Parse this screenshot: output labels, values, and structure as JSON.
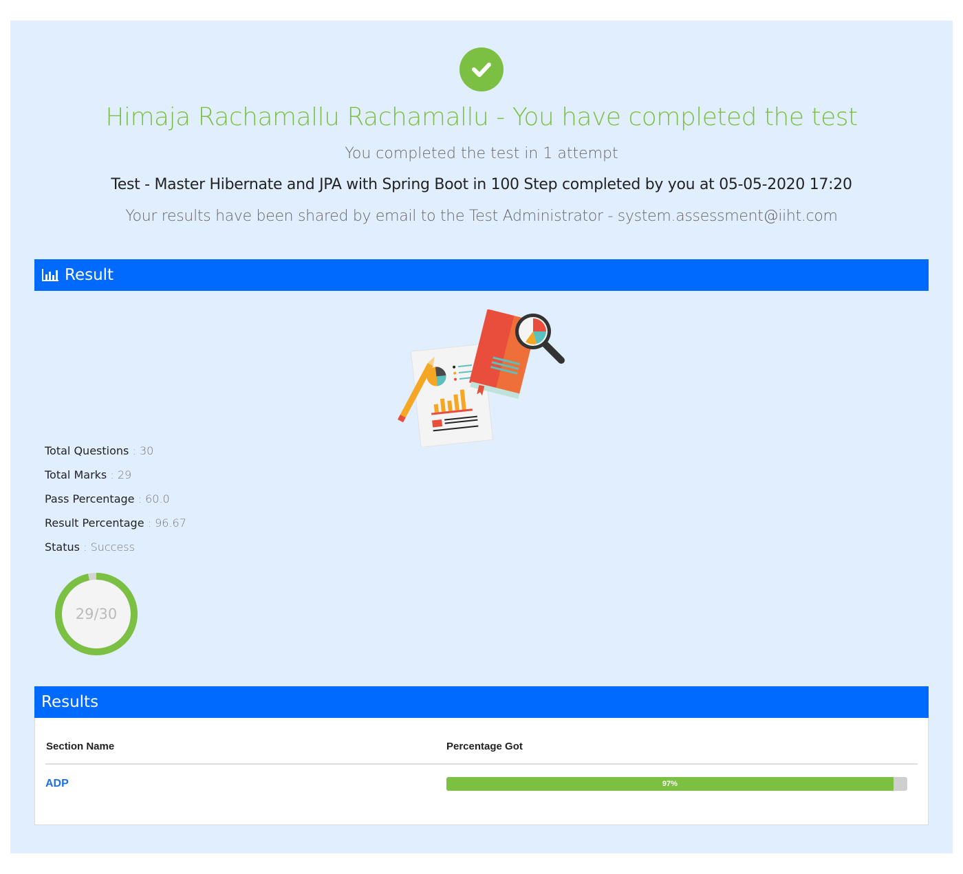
{
  "header": {
    "headline": "Himaja Rachamallu Rachamallu - You have completed the test",
    "attempts": "You completed the test in 1 attempt",
    "test_line": "Test - Master Hibernate and JPA with Spring Boot in 100 Step completed by you at 05-05-2020 17:20",
    "shared": "Your results have been shared by email to the Test Administrator - system.assessment@iiht.com"
  },
  "result_section": {
    "title": "Result",
    "stats": [
      {
        "label": "Total Questions",
        "value": "30"
      },
      {
        "label": "Total Marks",
        "value": "29"
      },
      {
        "label": "Pass Percentage",
        "value": "60.0"
      },
      {
        "label": "Result Percentage",
        "value": "96.67"
      },
      {
        "label": "Status",
        "value": "Success"
      }
    ],
    "score_ring": {
      "label": "29/30",
      "fraction": 0.9667
    }
  },
  "results_table": {
    "title": "Results",
    "columns": [
      "Section Name",
      "Percentage Got"
    ],
    "rows": [
      {
        "section": "ADP",
        "percent_label": "97%",
        "percent": 97
      }
    ]
  },
  "colors": {
    "accent_green": "#7bc043",
    "header_blue": "#0069fe",
    "panel_bg": "#e1eefd",
    "link_blue": "#1f6fe0"
  },
  "icons": [
    "check-circle-icon",
    "bar-chart-icon",
    "report-illustration"
  ]
}
